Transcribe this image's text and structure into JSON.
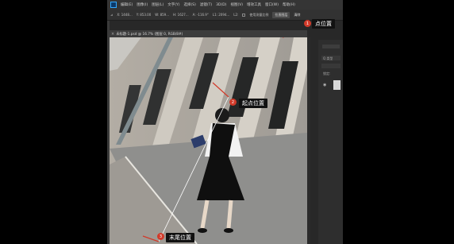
{
  "menu": {
    "items": [
      "编辑(E)",
      "图像(I)",
      "图层(L)",
      "文字(Y)",
      "选择(S)",
      "滤镜(T)",
      "3D(D)",
      "视图(V)",
      "增效工具",
      "窗口(W)",
      "帮助(H)"
    ]
  },
  "options": {
    "x_label": "X: 1448...",
    "y_label": "Y: 853.00",
    "w_label": "W: 859...",
    "h_label": "H: 1627...",
    "angle_label": "A: -116.9°",
    "l1_label": "L1: 2094...",
    "l2_label": "L2:",
    "use_scale_label": "使用测量比例",
    "straighten_label": "拉直图层",
    "clear_label": "清除"
  },
  "document": {
    "tab_title": "未标题-1.psd @ 16.7% (图层 0, RGB/8#)"
  },
  "panels": {
    "kind_label": "Q 类型",
    "lock_label": "锁定:"
  },
  "annotations": {
    "point_position": "点位置",
    "start_position": "起点位置",
    "end_position": "末尾位置",
    "badge1": "1",
    "badge2": "2",
    "badge3": "3"
  },
  "colors": {
    "annotation_red": "#d23a2a",
    "measure_line": "#ffffff"
  }
}
